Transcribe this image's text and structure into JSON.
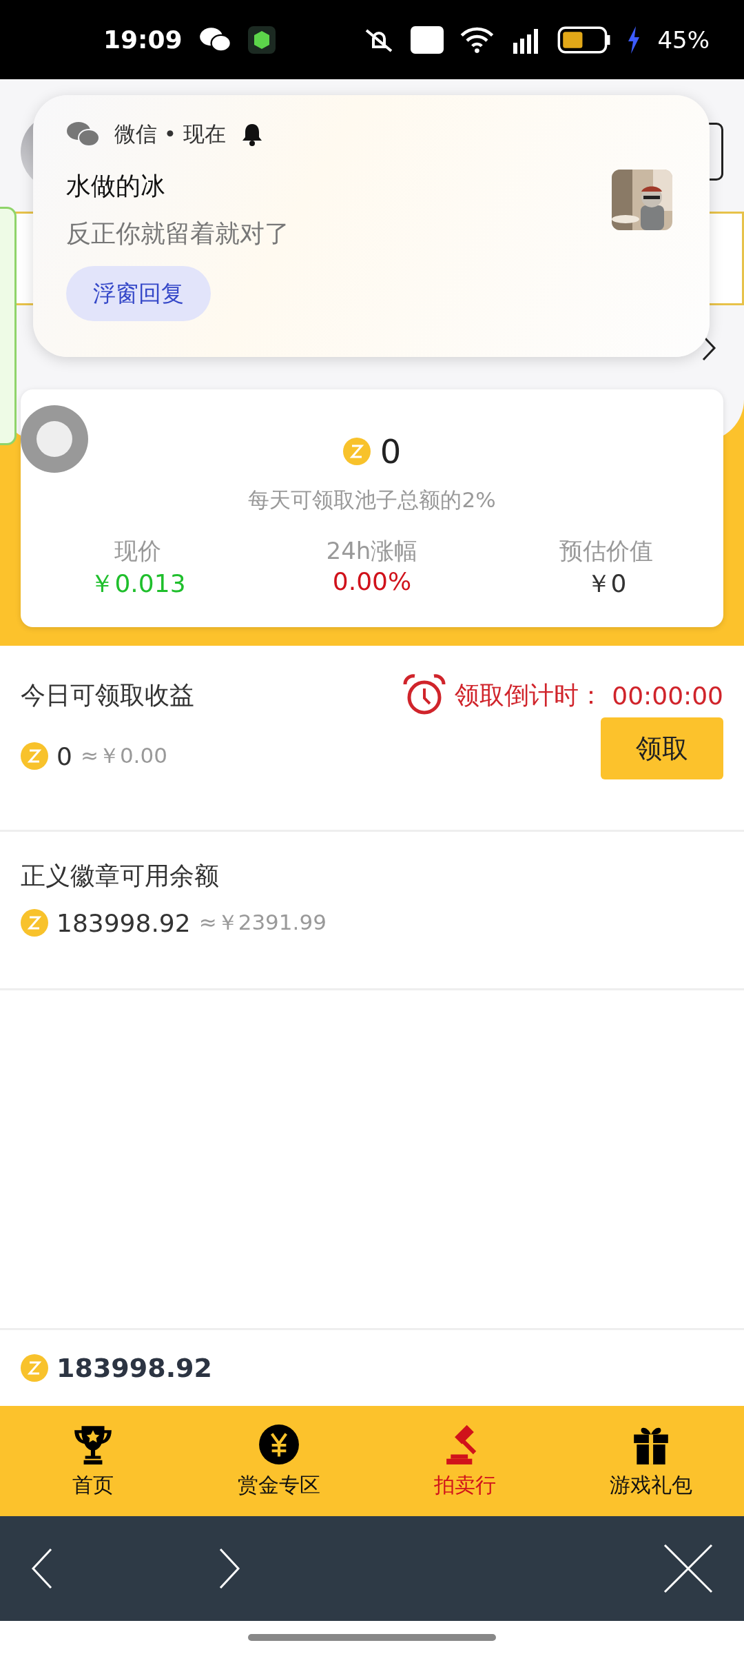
{
  "status_bar": {
    "time": "19:09",
    "battery": "45%"
  },
  "notification": {
    "app": "微信 • 现在",
    "sender": "水做的冰",
    "message": "反正你就留着就对了",
    "action": "浮窗回复"
  },
  "card": {
    "amount": "0",
    "note": "每天可领取池子总额的2%",
    "stats": [
      {
        "label": "现价",
        "value": "￥0.013",
        "color": "#1fbf2c"
      },
      {
        "label": "24h涨幅",
        "value": "0.00%",
        "color": "#d0121b"
      },
      {
        "label": "预估价值",
        "value": "￥0",
        "color": "#333333"
      }
    ]
  },
  "claim": {
    "title": "今日可领取收益",
    "countdown_label": "领取倒计时：",
    "countdown": "00:00:00",
    "amount": "0",
    "approx": "≈￥0.00",
    "button": "领取"
  },
  "balance": {
    "title": "正义徽章可用余额",
    "amount": "183998.92",
    "approx": "≈￥2391.99"
  },
  "total": "183998.92",
  "nav": [
    {
      "label": "首页",
      "selected": false
    },
    {
      "label": "赏金专区",
      "selected": false
    },
    {
      "label": "拍卖行",
      "selected": true
    },
    {
      "label": "游戏礼包",
      "selected": false
    }
  ]
}
